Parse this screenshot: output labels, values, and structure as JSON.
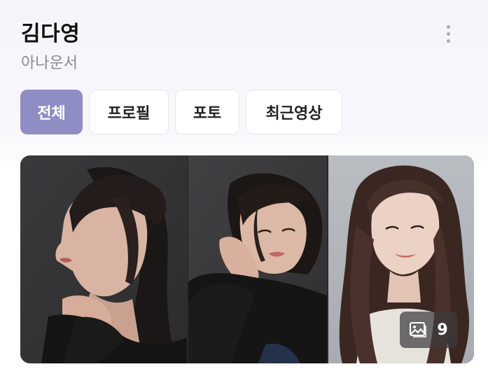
{
  "profile": {
    "name": "김다영",
    "role": "아나운서"
  },
  "tabs": [
    {
      "label": "전체",
      "active": true
    },
    {
      "label": "프로필",
      "active": false
    },
    {
      "label": "포토",
      "active": false
    },
    {
      "label": "최근영상",
      "active": false
    }
  ],
  "gallery": {
    "photo_count_badge": "9",
    "badge_icon": "image-gallery-icon"
  },
  "colors": {
    "accent": "#8f8ec4",
    "more_dots": "#a9a9c4"
  }
}
